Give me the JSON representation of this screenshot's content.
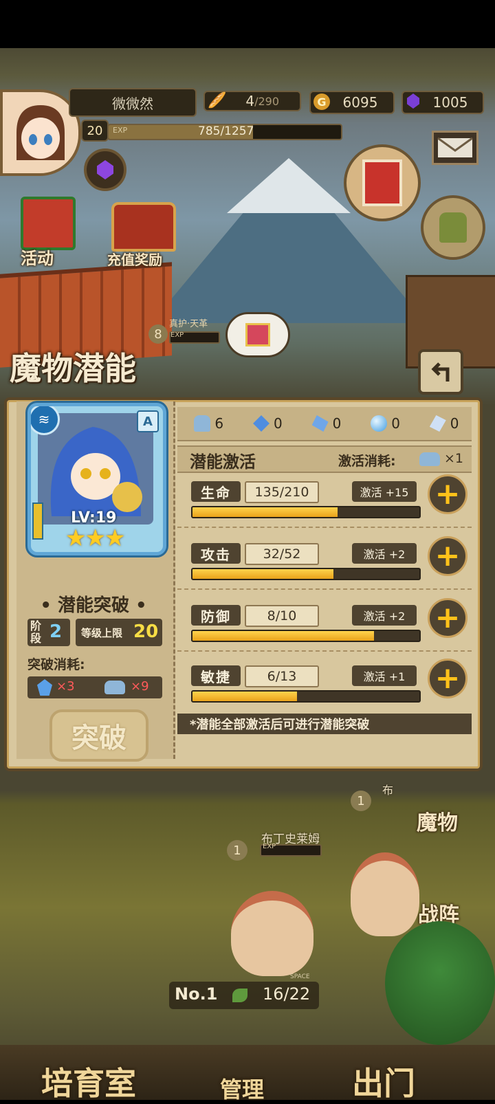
{
  "hud": {
    "player_name": "微微然",
    "level": "20",
    "exp_label": "EXP",
    "exp": "785/1257",
    "exp_ratio": 0.62,
    "stamina_current": "4",
    "stamina_max": "/290",
    "gold": "6095",
    "gems": "1005",
    "activity_label": "活动",
    "recharge_label": "充值奖励",
    "ninja_label": "真护·天革",
    "ninja_level": "8",
    "ninja_exp_label": "EXP"
  },
  "panel": {
    "title": "魔物潜能",
    "monster": {
      "level": "LV:19",
      "rank": "A",
      "stars": "★★★"
    },
    "breakthrough": {
      "title": "• 潜能突破 •",
      "stage_label": "阶段",
      "stage_value": "2",
      "cap_label": "等级上限",
      "cap_value": "20",
      "cost_label": "突破消耗:",
      "cost_items": [
        "×3",
        "×9"
      ],
      "button_label": "突破"
    },
    "resources": [
      "6",
      "0",
      "0",
      "0",
      "0"
    ],
    "activation": {
      "title": "潜能激活",
      "cost_label": "激活消耗:",
      "cost_amount": "×1"
    },
    "stats": [
      {
        "name": "生命",
        "value": "135/210",
        "activate": "激活 +15",
        "ratio": 0.643
      },
      {
        "name": "攻击",
        "value": "32/52",
        "activate": "激活 +2",
        "ratio": 0.615
      },
      {
        "name": "防御",
        "value": "8/10",
        "activate": "激活 +2",
        "ratio": 0.8
      },
      {
        "name": "敏捷",
        "value": "6/13",
        "activate": "激活 +1",
        "ratio": 0.462
      }
    ],
    "note": "*潜能全部激活后可进行潜能突破"
  },
  "field": {
    "monster_name": "布丁史莱姆",
    "monster_level": "1",
    "monster_level2": "1",
    "monster_tag": "布",
    "exp_label": "EXP",
    "monsters_label": "魔物",
    "formation_label": "战阵",
    "rank_label": "No.1",
    "space_label": "SPACE",
    "space": "16/22"
  },
  "nav": {
    "nursery": "培育室",
    "manage": "管理",
    "exit": "出门"
  },
  "colors": {
    "panel_bg": "#d8c79e",
    "bar_fill": "#f2b52a",
    "plus": "#ffc21a"
  }
}
